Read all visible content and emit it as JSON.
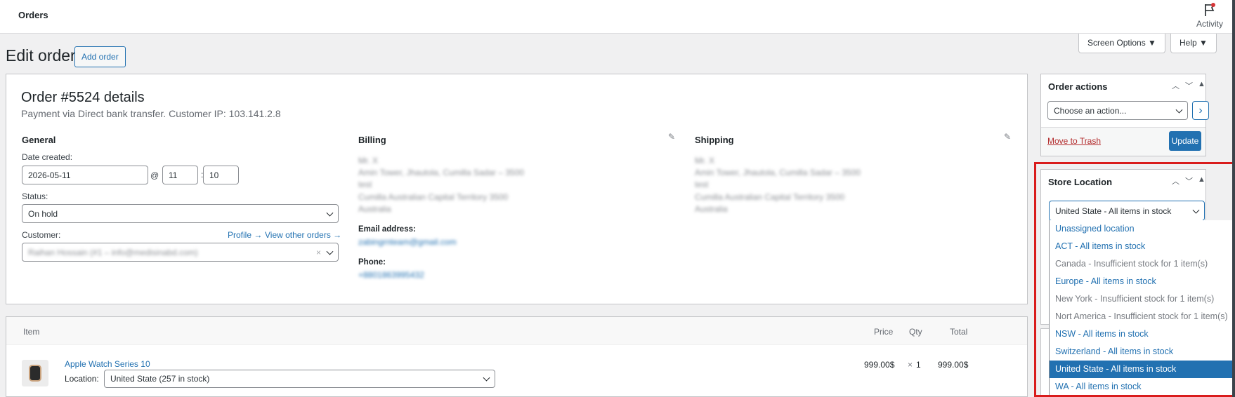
{
  "topbar": {
    "title": "Orders",
    "activity_label": "Activity",
    "activity_icon": "flag-icon"
  },
  "screen_options": "Screen Options ▼",
  "help": "Help ▼",
  "page": {
    "title": "Edit order",
    "add_button": "Add order"
  },
  "order": {
    "title": "Order #5524 details",
    "subtitle": "Payment via Direct bank transfer. Customer IP: 103.141.2.8",
    "general": {
      "heading": "General",
      "date_label": "Date created:",
      "date_value": "2026-05-11",
      "at_sign": "@",
      "hour": "11",
      "colon": ":",
      "minute": "10",
      "status_label": "Status:",
      "status_value": "On hold",
      "customer_label": "Customer:",
      "profile_link": "Profile →",
      "view_orders_link": "View other orders →",
      "customer_value": "Raihan Hossain (#1 – info@medisinabd.com)",
      "clear_glyph": "×"
    },
    "billing": {
      "heading": "Billing",
      "address_lines": [
        "Mr. X",
        "Amin Tower, Jhautola, Cumilla Sadar – 3500",
        "test",
        "Cumilla Australian Capital Territory 3500",
        "Australia"
      ],
      "email_label": "Email address:",
      "email_value": "zabingrnteam@gmail.com",
      "phone_label": "Phone:",
      "phone_value": "+8801863995432"
    },
    "shipping": {
      "heading": "Shipping",
      "address_lines": [
        "Mr. X",
        "Amin Tower, Jhautola, Cumilla Sadar – 3500",
        "test",
        "Cumilla Australian Capital Territory 3500",
        "Australia"
      ]
    }
  },
  "items": {
    "headers": {
      "item": "Item",
      "price": "Price",
      "qty": "Qty",
      "total": "Total"
    },
    "rows": [
      {
        "name": "Apple Watch Series 10",
        "location_label": "Location:",
        "location_value": "United State (257 in stock)",
        "price": "999.00$",
        "qty_prefix": "×",
        "qty": "1",
        "total": "999.00$"
      }
    ]
  },
  "order_actions": {
    "title": "Order actions",
    "select_value": "Choose an action...",
    "go_glyph": "›",
    "move_to_trash": "Move to Trash",
    "update": "Update"
  },
  "store_location": {
    "title": "Store Location",
    "selected": "United State - All items in stock",
    "options": [
      {
        "label": "Unassigned location",
        "state": "available"
      },
      {
        "label": "ACT - All items in stock",
        "state": "available"
      },
      {
        "label": "Canada - Insufficient stock for 1 item(s)",
        "state": "insufficient"
      },
      {
        "label": "Europe - All items in stock",
        "state": "available"
      },
      {
        "label": "New York - Insufficient stock for 1 item(s)",
        "state": "insufficient"
      },
      {
        "label": "Nort America - Insufficient stock for 1 item(s)",
        "state": "insufficient"
      },
      {
        "label": "NSW - All items in stock",
        "state": "available"
      },
      {
        "label": "Switzerland - All items in stock",
        "state": "available"
      },
      {
        "label": "United State - All items in stock",
        "state": "selected"
      },
      {
        "label": "WA - All items in stock",
        "state": "available"
      }
    ]
  },
  "colors": {
    "accent": "#2271b1",
    "highlight": "#d91c1c",
    "trash": "#b32d2e"
  }
}
